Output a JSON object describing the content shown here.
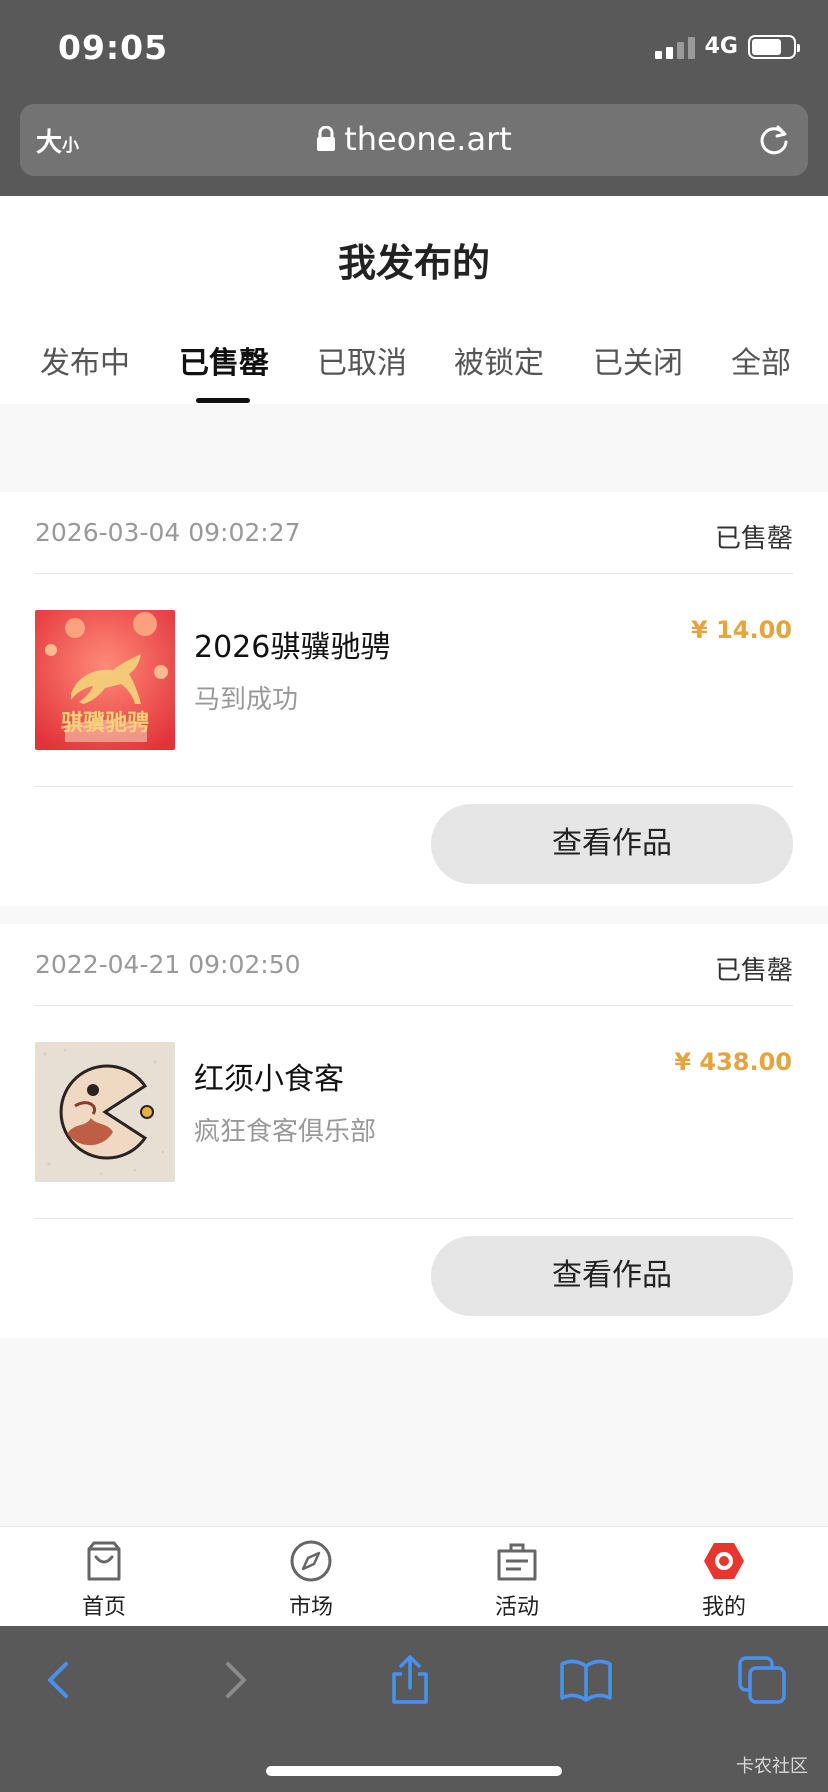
{
  "status_bar": {
    "time": "09:05",
    "network": "4G"
  },
  "browser": {
    "text_size_big": "大",
    "text_size_small": "小",
    "url": "theone.art"
  },
  "page": {
    "title": "我发布的"
  },
  "tabs": [
    {
      "label": "发布中",
      "active": false
    },
    {
      "label": "已售罄",
      "active": true
    },
    {
      "label": "已取消",
      "active": false
    },
    {
      "label": "被锁定",
      "active": false
    },
    {
      "label": "已关闭",
      "active": false
    },
    {
      "label": "全部",
      "active": false
    }
  ],
  "orders": [
    {
      "date": "2026-03-04 09:02:27",
      "status": "已售罄",
      "name": "2026骐骥驰骋",
      "subtitle": "马到成功",
      "price": "¥ 14.00",
      "thumb_text": "骐骥驰骋",
      "button": "查看作品"
    },
    {
      "date": "2022-04-21 09:02:50",
      "status": "已售罄",
      "name": "红须小食客",
      "subtitle": "疯狂食客俱乐部",
      "price": "¥ 438.00",
      "button": "查看作品"
    }
  ],
  "bottom_nav": [
    {
      "label": "首页",
      "icon": "bag-icon"
    },
    {
      "label": "市场",
      "icon": "compass-icon"
    },
    {
      "label": "活动",
      "icon": "ticket-icon"
    },
    {
      "label": "我的",
      "icon": "profile-hexagon-icon"
    }
  ],
  "watermark": "卡农社区",
  "colors": {
    "price": "#e8a33a",
    "chrome": "#595959",
    "safari_blue": "#4a90f0",
    "brand_red": "#e8362f"
  }
}
